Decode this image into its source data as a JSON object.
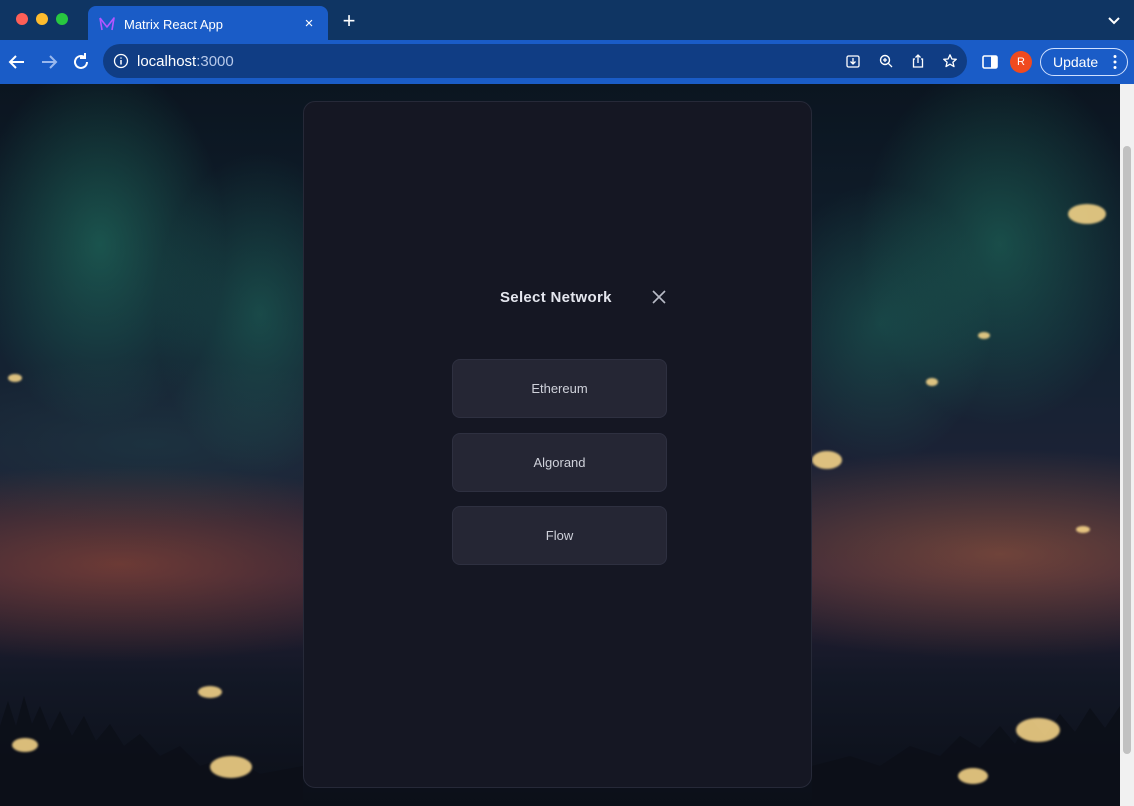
{
  "browser": {
    "tab": {
      "title": "Matrix React App",
      "close_glyph": "×"
    },
    "new_tab_glyph": "+",
    "url": {
      "host": "localhost",
      "port": ":3000"
    },
    "profile_initial": "R",
    "update_label": "Update"
  },
  "modal": {
    "title": "Select Network",
    "networks": [
      {
        "label": "Ethereum"
      },
      {
        "label": "Algorand"
      },
      {
        "label": "Flow"
      }
    ]
  },
  "colors": {
    "modal_bg": "#151723",
    "button_bg": "#252634",
    "chrome_blue": "#1a5cc7",
    "profile_accent": "#f04a1f"
  },
  "icons": {
    "tab_favicon": "matrix-logo-icon",
    "close": "close-icon",
    "back": "arrow-left-icon",
    "forward": "arrow-right-icon",
    "reload": "reload-icon",
    "info": "info-icon",
    "install": "install-icon",
    "zoom": "zoom-icon",
    "share": "share-icon",
    "bookmark": "star-icon",
    "side_panel": "side-panel-icon",
    "menu": "more-vert-icon"
  }
}
